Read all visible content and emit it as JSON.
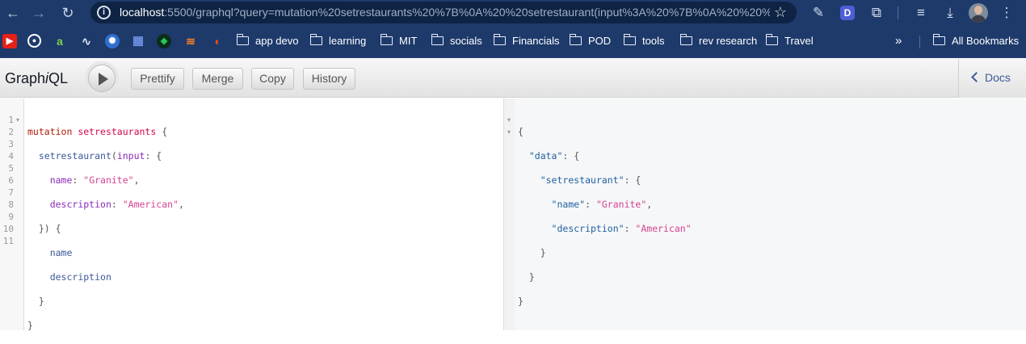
{
  "browser": {
    "url_host": "localhost",
    "url_rest": ":5500/graphql?query=mutation%20setrestaurants%20%7B%0A%20%20setrestaurant(input%3A%20%7B%0A%20%20%20%20...",
    "profile_letter": "D"
  },
  "bookmarks": {
    "folders": [
      "app devo",
      "learning",
      "MIT",
      "socials",
      "Financials",
      "POD",
      "tools",
      "rev research",
      "Travel"
    ],
    "overflow": "»",
    "all_bookmarks": "All Bookmarks"
  },
  "toolbar": {
    "title_prefix": "Graph",
    "title_italic": "i",
    "title_suffix": "QL",
    "prettify": "Prettify",
    "merge": "Merge",
    "copy": "Copy",
    "history": "History",
    "docs": "Docs"
  },
  "editor": {
    "line_numbers": [
      "1",
      "2",
      "3",
      "4",
      "5",
      "6",
      "7",
      "8",
      "9",
      "10",
      "11"
    ],
    "line1": {
      "kw": "mutation",
      "name": "setrestaurants",
      "brace": " {"
    },
    "line2": {
      "fn": "setrestaurant",
      "open": "(",
      "arg": "input",
      "rest": ": {"
    },
    "line3": {
      "key": "name",
      "colon": ": ",
      "value": "\"Granite\"",
      "comma": ","
    },
    "line4": {
      "key": "description",
      "colon": ": ",
      "value": "\"American\"",
      "comma": ","
    },
    "line5": "}) {",
    "line6": "name",
    "line7": "description",
    "line8": "}",
    "line9": "}"
  },
  "result": {
    "open": "{",
    "data_key": "\"data\"",
    "setrestaurant_key": "\"setrestaurant\"",
    "name_key": "\"name\"",
    "name_value": "\"Granite\"",
    "description_key": "\"description\"",
    "description_value": "\"American\"",
    "close_inner": "}",
    "close_mid": "}",
    "close_outer": "}"
  },
  "colors": {
    "browser_chrome": "#1e3a6b",
    "keyword": "#b11a04",
    "definition": "#d2054e",
    "field": "#3b5998",
    "argument": "#8b2bb9",
    "string": "#d64292",
    "result_key": "#1f61a0"
  },
  "icons": {
    "browser": [
      "back-arrow-icon",
      "forward-arrow-icon",
      "reload-icon",
      "info-icon",
      "star-icon",
      "eyedropper-icon",
      "extension-d-icon",
      "puzzle-icon",
      "playlist-icon",
      "download-icon",
      "kebab-menu-icon"
    ],
    "bookmarks": [
      "youtube-icon",
      "github-icon",
      "android-studio-icon",
      "zapier-icon",
      "settings-app-icon",
      "grid-apps-icon",
      "mongodb-icon",
      "stackoverflow-icon",
      "figma-icon"
    ]
  }
}
